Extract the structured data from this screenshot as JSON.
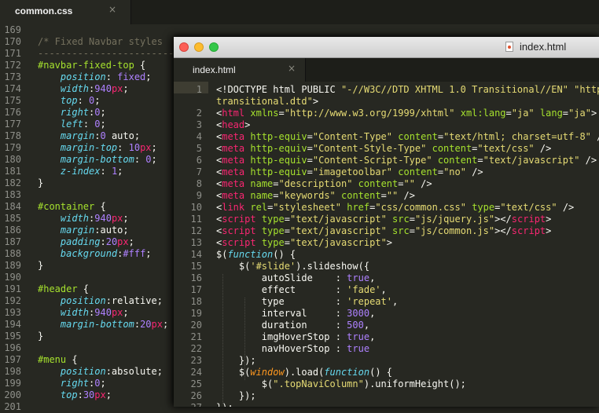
{
  "back_window": {
    "tab_title": "common.css",
    "close_glyph": "×",
    "line_numbers": [
      "169",
      "170",
      "171",
      "172",
      "173",
      "174",
      "175",
      "176",
      "177",
      "178",
      "179",
      "180",
      "181",
      "182",
      "183",
      "184",
      "185",
      "186",
      "187",
      "188",
      "189",
      "190",
      "191",
      "192",
      "193",
      "194",
      "195",
      "196",
      "197",
      "198",
      "199",
      "200",
      "201"
    ],
    "lines": [
      [],
      [
        [
          "t-com",
          "/* Fixed Navbar styles"
        ]
      ],
      [
        [
          "t-com",
          "------------------------------------------------------------------------"
        ]
      ],
      [
        [
          "t-sel",
          "#navbar-fixed-top"
        ],
        [
          "t-txt",
          " {"
        ]
      ],
      [
        [
          "t-txt",
          "    "
        ],
        [
          "t-prop",
          "position"
        ],
        [
          "t-txt",
          ": "
        ],
        [
          "t-kw",
          "fixed"
        ],
        [
          "t-txt",
          ";"
        ]
      ],
      [
        [
          "t-txt",
          "    "
        ],
        [
          "t-prop",
          "width"
        ],
        [
          "t-txt",
          ":"
        ],
        [
          "t-num",
          "940"
        ],
        [
          "t-unit",
          "px"
        ],
        [
          "t-txt",
          ";"
        ]
      ],
      [
        [
          "t-txt",
          "    "
        ],
        [
          "t-prop",
          "top"
        ],
        [
          "t-txt",
          ": "
        ],
        [
          "t-num",
          "0"
        ],
        [
          "t-txt",
          ";"
        ]
      ],
      [
        [
          "t-txt",
          "    "
        ],
        [
          "t-prop",
          "right"
        ],
        [
          "t-txt",
          ":"
        ],
        [
          "t-num",
          "0"
        ],
        [
          "t-txt",
          ";"
        ]
      ],
      [
        [
          "t-txt",
          "    "
        ],
        [
          "t-prop",
          "left"
        ],
        [
          "t-txt",
          ": "
        ],
        [
          "t-num",
          "0"
        ],
        [
          "t-txt",
          ";"
        ]
      ],
      [
        [
          "t-txt",
          "    "
        ],
        [
          "t-prop",
          "margin"
        ],
        [
          "t-txt",
          ":"
        ],
        [
          "t-num",
          "0"
        ],
        [
          "t-txt",
          " auto;"
        ]
      ],
      [
        [
          "t-txt",
          "    "
        ],
        [
          "t-prop",
          "margin-top"
        ],
        [
          "t-txt",
          ": "
        ],
        [
          "t-num",
          "10"
        ],
        [
          "t-unit",
          "px"
        ],
        [
          "t-txt",
          ";"
        ]
      ],
      [
        [
          "t-txt",
          "    "
        ],
        [
          "t-prop",
          "margin-bottom"
        ],
        [
          "t-txt",
          ": "
        ],
        [
          "t-num",
          "0"
        ],
        [
          "t-txt",
          ";"
        ]
      ],
      [
        [
          "t-txt",
          "    "
        ],
        [
          "t-prop",
          "z-index"
        ],
        [
          "t-txt",
          ": "
        ],
        [
          "t-num",
          "1"
        ],
        [
          "t-txt",
          ";"
        ]
      ],
      [
        [
          "t-txt",
          "}"
        ]
      ],
      [],
      [
        [
          "t-sel",
          "#container"
        ],
        [
          "t-txt",
          " {"
        ]
      ],
      [
        [
          "t-txt",
          "    "
        ],
        [
          "t-prop",
          "width"
        ],
        [
          "t-txt",
          ":"
        ],
        [
          "t-num",
          "940"
        ],
        [
          "t-unit",
          "px"
        ],
        [
          "t-txt",
          ";"
        ]
      ],
      [
        [
          "t-txt",
          "    "
        ],
        [
          "t-prop",
          "margin"
        ],
        [
          "t-txt",
          ":auto;"
        ]
      ],
      [
        [
          "t-txt",
          "    "
        ],
        [
          "t-prop",
          "padding"
        ],
        [
          "t-txt",
          ":"
        ],
        [
          "t-num",
          "20"
        ],
        [
          "t-unit",
          "px"
        ],
        [
          "t-txt",
          ";"
        ]
      ],
      [
        [
          "t-txt",
          "    "
        ],
        [
          "t-prop",
          "background"
        ],
        [
          "t-txt",
          ":"
        ],
        [
          "t-num",
          "#fff"
        ],
        [
          "t-txt",
          ";"
        ]
      ],
      [
        [
          "t-txt",
          "}"
        ]
      ],
      [],
      [
        [
          "t-sel",
          "#header"
        ],
        [
          "t-txt",
          " {"
        ]
      ],
      [
        [
          "t-txt",
          "    "
        ],
        [
          "t-prop",
          "position"
        ],
        [
          "t-txt",
          ":relative;"
        ]
      ],
      [
        [
          "t-txt",
          "    "
        ],
        [
          "t-prop",
          "width"
        ],
        [
          "t-txt",
          ":"
        ],
        [
          "t-num",
          "940"
        ],
        [
          "t-unit",
          "px"
        ],
        [
          "t-txt",
          ";"
        ]
      ],
      [
        [
          "t-txt",
          "    "
        ],
        [
          "t-prop",
          "margin-bottom"
        ],
        [
          "t-txt",
          ":"
        ],
        [
          "t-num",
          "20"
        ],
        [
          "t-unit",
          "px"
        ],
        [
          "t-txt",
          ";"
        ]
      ],
      [
        [
          "t-txt",
          "}"
        ]
      ],
      [],
      [
        [
          "t-sel",
          "#menu"
        ],
        [
          "t-txt",
          " {"
        ]
      ],
      [
        [
          "t-txt",
          "    "
        ],
        [
          "t-prop",
          "position"
        ],
        [
          "t-txt",
          ":absolute;"
        ]
      ],
      [
        [
          "t-txt",
          "    "
        ],
        [
          "t-prop",
          "right"
        ],
        [
          "t-txt",
          ":"
        ],
        [
          "t-num",
          "0"
        ],
        [
          "t-txt",
          ";"
        ]
      ],
      [
        [
          "t-txt",
          "    "
        ],
        [
          "t-prop",
          "top"
        ],
        [
          "t-txt",
          ":"
        ],
        [
          "t-num",
          "30"
        ],
        [
          "t-unit",
          "px"
        ],
        [
          "t-txt",
          ";"
        ]
      ],
      []
    ]
  },
  "front_window": {
    "window_title": "index.html",
    "tab_title": "index.html",
    "close_glyph": "×",
    "current_line": "1",
    "line_numbers": [
      "1",
      "",
      "2",
      "3",
      "4",
      "5",
      "6",
      "7",
      "8",
      "9",
      "10",
      "11",
      "12",
      "13",
      "14",
      "15",
      "16",
      "17",
      "18",
      "19",
      "20",
      "21",
      "22",
      "23",
      "24",
      "25",
      "26",
      "27"
    ],
    "lines": [
      [
        [
          "t-txt",
          "<!DOCTYPE html PUBLIC "
        ],
        [
          "t-str",
          "\"-//W3C//DTD XHTML 1.0 Transitional//EN\""
        ],
        [
          "t-txt",
          " "
        ],
        [
          "t-str",
          "\"http://"
        ]
      ],
      [
        [
          "t-str",
          "transitional.dtd\""
        ],
        [
          "t-txt",
          ">"
        ]
      ],
      [
        [
          "t-txt",
          "<"
        ],
        [
          "t-tag",
          "html"
        ],
        [
          "t-txt",
          " "
        ],
        [
          "t-attr",
          "xmlns"
        ],
        [
          "t-txt",
          "="
        ],
        [
          "t-str",
          "\"http://www.w3.org/1999/xhtml\""
        ],
        [
          "t-txt",
          " "
        ],
        [
          "t-attr",
          "xml:lang"
        ],
        [
          "t-txt",
          "="
        ],
        [
          "t-str",
          "\"ja\""
        ],
        [
          "t-txt",
          " "
        ],
        [
          "t-attr",
          "lang"
        ],
        [
          "t-txt",
          "="
        ],
        [
          "t-str",
          "\"ja\""
        ],
        [
          "t-txt",
          ">"
        ]
      ],
      [
        [
          "t-txt",
          "<"
        ],
        [
          "t-tag",
          "head"
        ],
        [
          "t-txt",
          ">"
        ]
      ],
      [
        [
          "t-txt",
          "<"
        ],
        [
          "t-tag",
          "meta"
        ],
        [
          "t-txt",
          " "
        ],
        [
          "t-attr",
          "http-equiv"
        ],
        [
          "t-txt",
          "="
        ],
        [
          "t-str",
          "\"Content-Type\""
        ],
        [
          "t-txt",
          " "
        ],
        [
          "t-attr",
          "content"
        ],
        [
          "t-txt",
          "="
        ],
        [
          "t-str",
          "\"text/html; charset=utf-8\""
        ],
        [
          "t-txt",
          " />"
        ]
      ],
      [
        [
          "t-txt",
          "<"
        ],
        [
          "t-tag",
          "meta"
        ],
        [
          "t-txt",
          " "
        ],
        [
          "t-attr",
          "http-equiv"
        ],
        [
          "t-txt",
          "="
        ],
        [
          "t-str",
          "\"Content-Style-Type\""
        ],
        [
          "t-txt",
          " "
        ],
        [
          "t-attr",
          "content"
        ],
        [
          "t-txt",
          "="
        ],
        [
          "t-str",
          "\"text/css\""
        ],
        [
          "t-txt",
          " />"
        ]
      ],
      [
        [
          "t-txt",
          "<"
        ],
        [
          "t-tag",
          "meta"
        ],
        [
          "t-txt",
          " "
        ],
        [
          "t-attr",
          "http-equiv"
        ],
        [
          "t-txt",
          "="
        ],
        [
          "t-str",
          "\"Content-Script-Type\""
        ],
        [
          "t-txt",
          " "
        ],
        [
          "t-attr",
          "content"
        ],
        [
          "t-txt",
          "="
        ],
        [
          "t-str",
          "\"text/javascript\""
        ],
        [
          "t-txt",
          " />"
        ]
      ],
      [
        [
          "t-txt",
          "<"
        ],
        [
          "t-tag",
          "meta"
        ],
        [
          "t-txt",
          " "
        ],
        [
          "t-attr",
          "http-equiv"
        ],
        [
          "t-txt",
          "="
        ],
        [
          "t-str",
          "\"imagetoolbar\""
        ],
        [
          "t-txt",
          " "
        ],
        [
          "t-attr",
          "content"
        ],
        [
          "t-txt",
          "="
        ],
        [
          "t-str",
          "\"no\""
        ],
        [
          "t-txt",
          " />"
        ]
      ],
      [
        [
          "t-txt",
          "<"
        ],
        [
          "t-tag",
          "meta"
        ],
        [
          "t-txt",
          " "
        ],
        [
          "t-attr",
          "name"
        ],
        [
          "t-txt",
          "="
        ],
        [
          "t-str",
          "\"description\""
        ],
        [
          "t-txt",
          " "
        ],
        [
          "t-attr",
          "content"
        ],
        [
          "t-txt",
          "="
        ],
        [
          "t-str",
          "\"\""
        ],
        [
          "t-txt",
          " />"
        ]
      ],
      [
        [
          "t-txt",
          "<"
        ],
        [
          "t-tag",
          "meta"
        ],
        [
          "t-txt",
          " "
        ],
        [
          "t-attr",
          "name"
        ],
        [
          "t-txt",
          "="
        ],
        [
          "t-str",
          "\"keywords\""
        ],
        [
          "t-txt",
          " "
        ],
        [
          "t-attr",
          "content"
        ],
        [
          "t-txt",
          "="
        ],
        [
          "t-str",
          "\"\""
        ],
        [
          "t-txt",
          " />"
        ]
      ],
      [
        [
          "t-txt",
          "<"
        ],
        [
          "t-tag",
          "link"
        ],
        [
          "t-txt",
          " "
        ],
        [
          "t-attr",
          "rel"
        ],
        [
          "t-txt",
          "="
        ],
        [
          "t-str",
          "\"stylesheet\""
        ],
        [
          "t-txt",
          " "
        ],
        [
          "t-attr",
          "href"
        ],
        [
          "t-txt",
          "="
        ],
        [
          "t-str",
          "\"css/common.css\""
        ],
        [
          "t-txt",
          " "
        ],
        [
          "t-attr",
          "type"
        ],
        [
          "t-txt",
          "="
        ],
        [
          "t-str",
          "\"text/css\""
        ],
        [
          "t-txt",
          " />"
        ]
      ],
      [
        [
          "t-txt",
          "<"
        ],
        [
          "t-tag",
          "script"
        ],
        [
          "t-txt",
          " "
        ],
        [
          "t-attr",
          "type"
        ],
        [
          "t-txt",
          "="
        ],
        [
          "t-str",
          "\"text/javascript\""
        ],
        [
          "t-txt",
          " "
        ],
        [
          "t-attr",
          "src"
        ],
        [
          "t-txt",
          "="
        ],
        [
          "t-str",
          "\"js/jquery.js\""
        ],
        [
          "t-txt",
          "></"
        ],
        [
          "t-tag",
          "script"
        ],
        [
          "t-txt",
          ">"
        ]
      ],
      [
        [
          "t-txt",
          "<"
        ],
        [
          "t-tag",
          "script"
        ],
        [
          "t-txt",
          " "
        ],
        [
          "t-attr",
          "type"
        ],
        [
          "t-txt",
          "="
        ],
        [
          "t-str",
          "\"text/javascript\""
        ],
        [
          "t-txt",
          " "
        ],
        [
          "t-attr",
          "src"
        ],
        [
          "t-txt",
          "="
        ],
        [
          "t-str",
          "\"js/common.js\""
        ],
        [
          "t-txt",
          "></"
        ],
        [
          "t-tag",
          "script"
        ],
        [
          "t-txt",
          ">"
        ]
      ],
      [
        [
          "t-txt",
          "<"
        ],
        [
          "t-tag",
          "script"
        ],
        [
          "t-txt",
          " "
        ],
        [
          "t-attr",
          "type"
        ],
        [
          "t-txt",
          "="
        ],
        [
          "t-str",
          "\"text/javascript\""
        ],
        [
          "t-txt",
          ">"
        ]
      ],
      [
        [
          "t-txt",
          "$("
        ],
        [
          "t-fn",
          "function"
        ],
        [
          "t-txt",
          "() {"
        ]
      ],
      [
        [
          "t-txt",
          "    $("
        ],
        [
          "t-str",
          "'#slide'"
        ],
        [
          "t-txt",
          ").slideshow({"
        ]
      ],
      [
        [
          "t-txt",
          "        autoSlide    : "
        ],
        [
          "t-kw",
          "true"
        ],
        [
          "t-txt",
          ","
        ]
      ],
      [
        [
          "t-txt",
          "        effect       : "
        ],
        [
          "t-str",
          "'fade'"
        ],
        [
          "t-txt",
          ","
        ]
      ],
      [
        [
          "t-txt",
          "        type         : "
        ],
        [
          "t-str",
          "'repeat'"
        ],
        [
          "t-txt",
          ","
        ]
      ],
      [
        [
          "t-txt",
          "        interval     : "
        ],
        [
          "t-kw",
          "3000"
        ],
        [
          "t-txt",
          ","
        ]
      ],
      [
        [
          "t-txt",
          "        duration     : "
        ],
        [
          "t-kw",
          "500"
        ],
        [
          "t-txt",
          ","
        ]
      ],
      [
        [
          "t-txt",
          "        imgHoverStop : "
        ],
        [
          "t-kw",
          "true"
        ],
        [
          "t-txt",
          ","
        ]
      ],
      [
        [
          "t-txt",
          "        navHoverStop : "
        ],
        [
          "t-kw",
          "true"
        ]
      ],
      [
        [
          "t-txt",
          "    });"
        ]
      ],
      [
        [
          "t-txt",
          "    $("
        ],
        [
          "t-var",
          "window"
        ],
        [
          "t-txt",
          ").load("
        ],
        [
          "t-fn",
          "function"
        ],
        [
          "t-txt",
          "() {"
        ]
      ],
      [
        [
          "t-txt",
          "        $("
        ],
        [
          "t-str",
          "\".topNaviColumn\""
        ],
        [
          "t-txt",
          ").uniformHeight();"
        ]
      ],
      [
        [
          "t-txt",
          "    });"
        ]
      ],
      [
        [
          "t-txt",
          "});"
        ]
      ]
    ]
  }
}
